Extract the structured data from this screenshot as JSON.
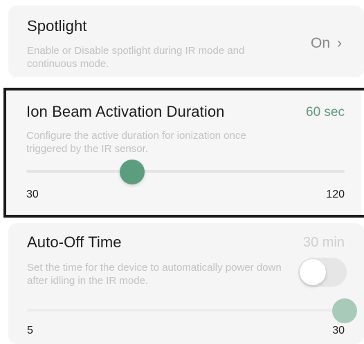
{
  "spotlight": {
    "title": "Spotlight",
    "description": "Enable or Disable spotlight during IR mode and continuous mode.",
    "value": "On",
    "chevron": "›"
  },
  "ion_beam": {
    "title": "Ion Beam Activation Duration",
    "value": "60 sec",
    "description": "Configure the active duration for ionization once triggered by the IR sensor.",
    "slider": {
      "min": 30,
      "max": 120,
      "current": 60,
      "min_label": "30",
      "max_label": "120"
    },
    "accent_color": "#5b9d7f"
  },
  "auto_off": {
    "title": "Auto-Off Time",
    "value": "30 min",
    "description": "Set the time for the device to automatically power down after idling in the IR mode.",
    "toggle_on": false,
    "slider": {
      "min": 5,
      "max": 30,
      "current": 30,
      "min_label": "5",
      "max_label": "30"
    },
    "accent_color": "#a8cbb9"
  }
}
